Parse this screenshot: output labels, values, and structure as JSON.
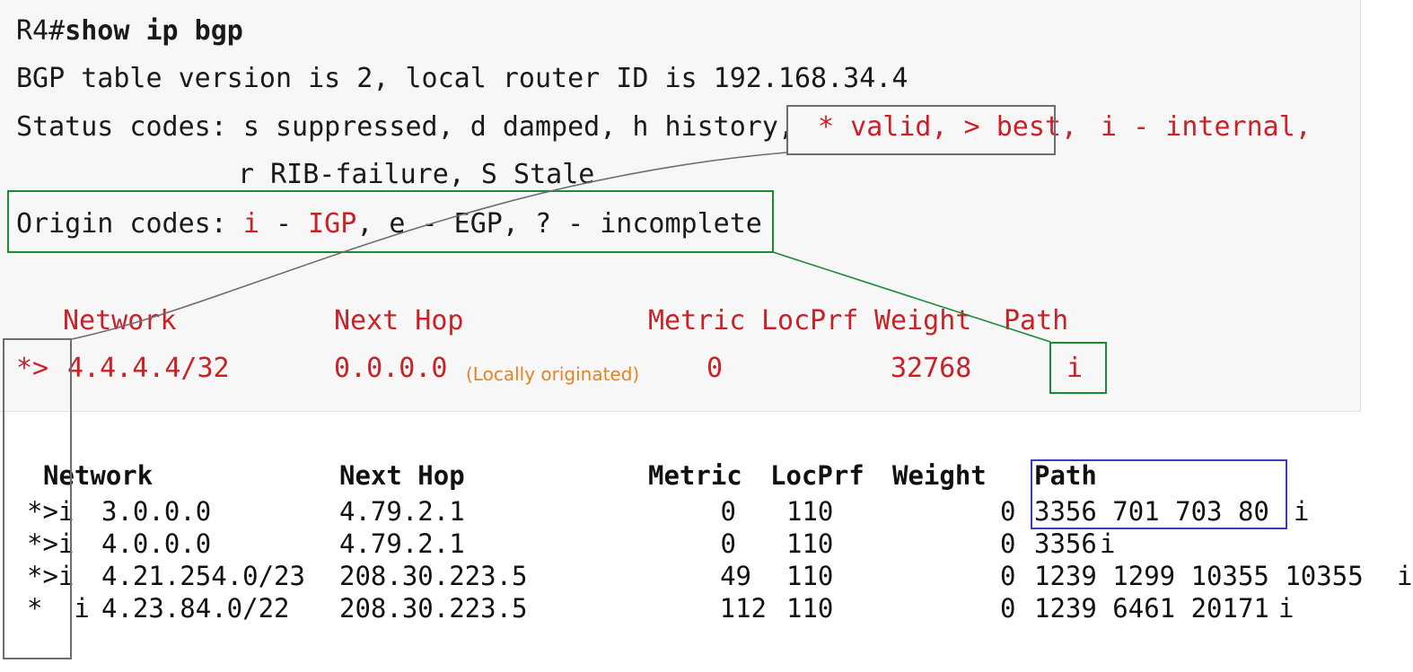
{
  "console": {
    "prompt": "R4#",
    "command": "show ip bgp",
    "version_line": "BGP table version is 2, local router ID is 192.168.34.4",
    "status_codes_label": "Status codes: s suppressed, d damped, h history, ",
    "status_codes_highlight": "* valid, > best,",
    "status_codes_tail": " i - internal,",
    "status_codes_line2": "r RIB-failure, S Stale",
    "origin_codes_label": "Origin codes: ",
    "origin_codes_i": "i",
    "origin_codes_dash": " - ",
    "origin_codes_igp": "IGP",
    "origin_codes_tail": ", e - EGP, ? - incomplete",
    "table": {
      "headers": {
        "network": "Network",
        "next_hop": "Next Hop",
        "metric": "Metric",
        "locprf": "LocPrf",
        "weight": "Weight",
        "path": "Path"
      },
      "row": {
        "status": "*>",
        "network": "4.4.4.4/32",
        "next_hop": "0.0.0.0",
        "next_hop_note": "(Locally originated)",
        "metric": "0",
        "locprf": "",
        "weight": "32768",
        "path": "i"
      }
    }
  },
  "bgp_table": {
    "headers": {
      "network": "Network",
      "next_hop": "Next Hop",
      "metric": "Metric",
      "locprf": "LocPrf",
      "weight": "Weight",
      "path": "Path"
    },
    "rows": [
      {
        "status": "*>i",
        "network": "3.0.0.0",
        "next_hop": "4.79.2.1",
        "metric": "0",
        "locprf": "110",
        "weight": "0",
        "path": "3356 701 703 80",
        "origin": "i"
      },
      {
        "status": "*>i",
        "network": "4.0.0.0",
        "next_hop": "4.79.2.1",
        "metric": "0",
        "locprf": "110",
        "weight": "0",
        "path": "3356",
        "origin": "i"
      },
      {
        "status": "*>i",
        "network": "4.21.254.0/23",
        "next_hop": "208.30.223.5",
        "metric": "49",
        "locprf": "110",
        "weight": "0",
        "path": "1239 1299 10355 10355",
        "origin": "i"
      },
      {
        "status": "*  i",
        "network": "4.23.84.0/22",
        "next_hop": "208.30.223.5",
        "metric": "112",
        "locprf": "110",
        "weight": "0",
        "path": "1239 6461 20171",
        "origin": "i"
      }
    ]
  },
  "annotations": {
    "highlight_status_codes": "* valid, > best,",
    "highlight_origin_codes_box": "Origin codes: i - IGP, e - EGP, ? - incomplete",
    "highlight_path_value_box": "i",
    "highlight_status_column_box": "status code column",
    "highlight_path_column_box": "Path"
  },
  "colors": {
    "panel_bg": "#f7f7f7",
    "console_red": "#cc2027",
    "note_orange": "#e8821e",
    "box_grey": "#6d6d6d",
    "box_green": "#1a8a33",
    "box_blue": "#3b3bbf",
    "text_black": "#111111"
  }
}
